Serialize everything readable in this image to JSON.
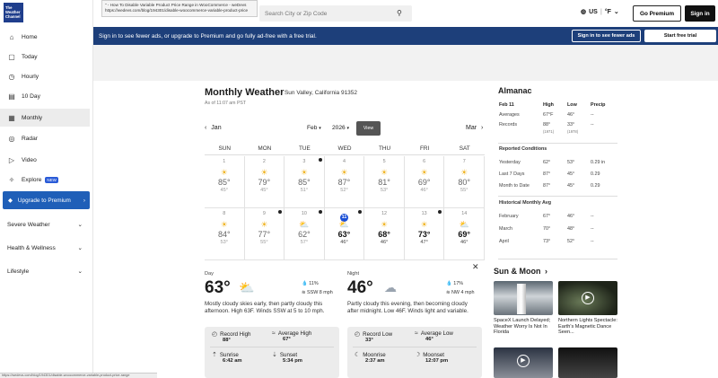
{
  "logo": {
    "line1": "The",
    "line2": "Weather",
    "line3": "Channel"
  },
  "sidebar": {
    "items": [
      {
        "label": "Home",
        "icon": "home-icon",
        "glyph": "⌂"
      },
      {
        "label": "Today",
        "icon": "today-icon",
        "glyph": "▢"
      },
      {
        "label": "Hourly",
        "icon": "clock-icon",
        "glyph": "◷"
      },
      {
        "label": "10 Day",
        "icon": "calendar-icon",
        "glyph": "▤"
      },
      {
        "label": "Monthly",
        "icon": "calendar-month-icon",
        "glyph": "▦"
      },
      {
        "label": "Radar",
        "icon": "radar-icon",
        "glyph": "◎"
      },
      {
        "label": "Video",
        "icon": "video-icon",
        "glyph": "▷"
      },
      {
        "label": "Explore",
        "icon": "compass-icon",
        "glyph": "✧",
        "badge": "NEW"
      }
    ],
    "premium": "Upgrade to Premium",
    "sections": [
      "Severe Weather",
      "Health & Wellness",
      "Lifestyle"
    ]
  },
  "topbar": {
    "tab_tooltip_line1": "\" - How To Disable Variable Product Price Range in WooCommerce - weDevs",
    "tab_tooltip_line2": "https://wedevs.com/blog/194301/disable-woocommerce-variable-product-price",
    "search_placeholder": "Search City or Zip Code",
    "unit_country": "US",
    "unit_temp": "°F",
    "go_premium": "Go Premium",
    "signin": "Sign in"
  },
  "banner": {
    "text": "Sign in to see fewer ads, or upgrade to Premium and go fully ad-free with a free trial.",
    "signin_btn": "Sign in to see fewer ads",
    "trial_btn": "Start free trial"
  },
  "monthly": {
    "title": "Monthly Weather",
    "location": "- Sun Valley, California 91352",
    "as_of": "As of 11:07 am PST",
    "prev_month": "Jan",
    "month": "Feb",
    "year": "2026",
    "view_btn": "View",
    "next_month": "Mar",
    "days_of_week": [
      "SUN",
      "MON",
      "TUE",
      "WED",
      "THU",
      "FRI",
      "SAT"
    ],
    "weeks": [
      [
        {
          "day": "1",
          "hi": "85°",
          "lo": "45°",
          "wx": "☀"
        },
        {
          "day": "2",
          "hi": "79°",
          "lo": "45°",
          "wx": "☀"
        },
        {
          "day": "3",
          "hi": "85°",
          "lo": "51°",
          "wx": "☀"
        },
        {
          "day": "4",
          "hi": "87°",
          "lo": "52°",
          "wx": "☀"
        },
        {
          "day": "5",
          "hi": "81°",
          "lo": "53°",
          "wx": "☀"
        },
        {
          "day": "6",
          "hi": "69°",
          "lo": "46°",
          "wx": "☀"
        },
        {
          "day": "7",
          "hi": "80°",
          "lo": "55°",
          "wx": "☀"
        }
      ],
      [
        {
          "day": "8",
          "hi": "84°",
          "lo": "53°",
          "wx": "☀"
        },
        {
          "day": "9",
          "hi": "77°",
          "lo": "55°",
          "wx": "☀"
        },
        {
          "day": "10",
          "hi": "62°",
          "lo": "57°",
          "wx": "⛅"
        },
        {
          "day": "11",
          "hi": "63°",
          "lo": "46°",
          "wx": "⛅",
          "today": true
        },
        {
          "day": "12",
          "hi": "68°",
          "lo": "46°",
          "wx": "☀",
          "future": true
        },
        {
          "day": "13",
          "hi": "73°",
          "lo": "47°",
          "wx": "☀",
          "future": true
        },
        {
          "day": "14",
          "hi": "69°",
          "lo": "46°",
          "wx": "⛅",
          "future": true
        }
      ]
    ]
  },
  "detail": {
    "day_label": "Day",
    "day_temp": "63°",
    "day_precip": "11%",
    "day_wind": "SSW 8 mph",
    "day_desc": "Mostly cloudy skies early, then partly cloudy this afternoon. High 63F. Winds SSW at 5 to 10 mph.",
    "night_label": "Night",
    "night_temp": "46°",
    "night_precip": "17%",
    "night_wind": "NW 4 mph",
    "night_desc": "Partly cloudy this evening, then becoming cloudy after midnight. Low 46F. Winds light and variable.",
    "record_high_label": "Record High",
    "record_high": "88°",
    "avg_high_label": "Average High",
    "avg_high": "67°",
    "sunrise_label": "Sunrise",
    "sunrise": "6:42 am",
    "sunset_label": "Sunset",
    "sunset": "5:34 pm",
    "record_low_label": "Record Low",
    "record_low": "33°",
    "avg_low_label": "Average Low",
    "avg_low": "46°",
    "moonrise_label": "Moonrise",
    "moonrise": "2:37 am",
    "moonset_label": "Moonset",
    "moonset": "12:07 pm"
  },
  "almanac": {
    "title": "Almanac",
    "date": "Feb 11",
    "col_high": "High",
    "col_low": "Low",
    "col_precip": "Precip",
    "averages_label": "Averages",
    "averages_high": "67°F",
    "averages_low": "46°",
    "averages_precip": "--",
    "records_label": "Records",
    "records_high": "88°",
    "records_high_year": "(1971)",
    "records_low": "33°",
    "records_low_year": "(1978)",
    "records_precip": "--",
    "reported_title": "Reported Conditions",
    "reported": [
      {
        "label": "Yesterday",
        "high": "62°",
        "low": "53°",
        "precip": "0.29 in"
      },
      {
        "label": "Last 7 Days",
        "high": "87°",
        "low": "45°",
        "precip": "0.29"
      },
      {
        "label": "Month to Date",
        "high": "87°",
        "low": "45°",
        "precip": "0.29"
      }
    ],
    "historical_title": "Historical Monthly Avg",
    "historical": [
      {
        "label": "February",
        "high": "67°",
        "low": "46°",
        "precip": "--"
      },
      {
        "label": "March",
        "high": "70°",
        "low": "48°",
        "precip": "--"
      },
      {
        "label": "April",
        "high": "73°",
        "low": "52°",
        "precip": "--"
      }
    ]
  },
  "sun_moon": {
    "title": "Sun & Moon",
    "story1": "SpaceX Launch Delayed; Weather Worry Is Not In Florida",
    "story2": "Northern Lights Spectacle: Earth's Magnetic Dance Seen..."
  },
  "status_url": "https://wedevs.com/blog/194301/disable-woocommerce-variable-product-price-range"
}
